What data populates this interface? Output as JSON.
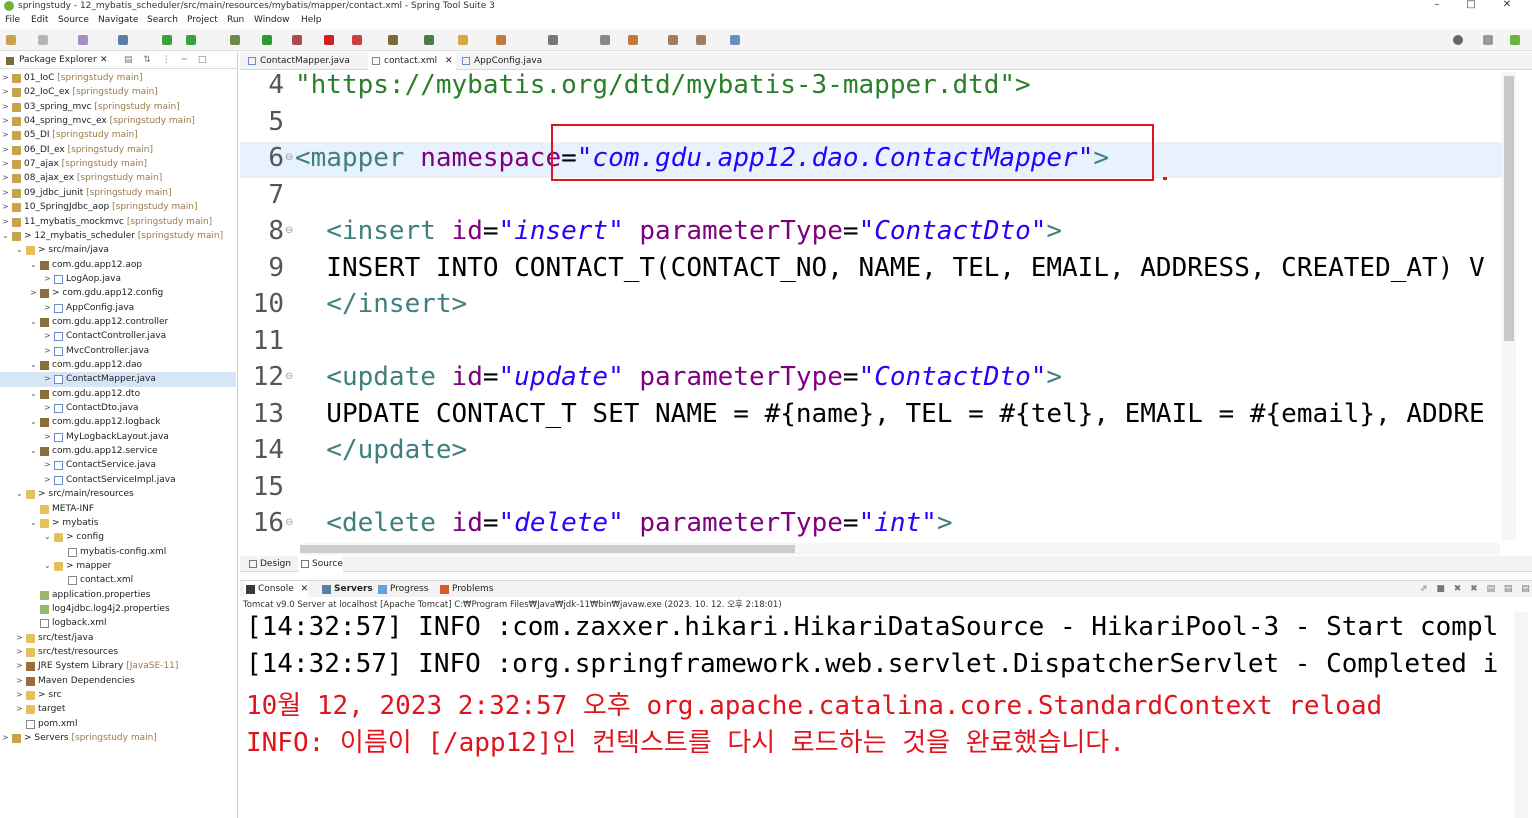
{
  "window": {
    "title": "springstudy - 12_mybatis_scheduler/src/main/resources/mybatis/mapper/contact.xml - Spring Tool Suite 3",
    "minimize": "–",
    "maximize": "□",
    "close": "✕"
  },
  "menu": [
    "File",
    "Edit",
    "Source",
    "Navigate",
    "Search",
    "Project",
    "Run",
    "Window",
    "Help"
  ],
  "explorer": {
    "title": "Package Explorer",
    "close": "✕",
    "tools": "▤ ⇅ ⋮ ─ □",
    "items": [
      {
        "label": "01_IoC",
        "suffix": " [springstudy main]"
      },
      {
        "label": "02_IoC_ex",
        "suffix": " [springstudy main]"
      },
      {
        "label": "03_spring_mvc",
        "suffix": " [springstudy main]"
      },
      {
        "label": "04_spring_mvc_ex",
        "suffix": " [springstudy main]"
      },
      {
        "label": "05_DI",
        "suffix": " [springstudy main]"
      },
      {
        "label": "06_DI_ex",
        "suffix": " [springstudy main]"
      },
      {
        "label": "07_ajax",
        "suffix": " [springstudy main]"
      },
      {
        "label": "08_ajax_ex",
        "suffix": " [springstudy main]"
      },
      {
        "label": "09_jdbc_junit",
        "suffix": " [springstudy main]"
      },
      {
        "label": "10_SpringJdbc_aop",
        "suffix": " [springstudy main]"
      },
      {
        "label": "11_mybatis_mockmvc",
        "suffix": " [springstudy main]"
      },
      {
        "label": "> 12_mybatis_scheduler",
        "suffix": " [springstudy main]"
      },
      {
        "label": "> src/main/java",
        "suffix": ""
      },
      {
        "label": "com.gdu.app12.aop",
        "suffix": ""
      },
      {
        "label": "LogAop.java",
        "suffix": ""
      },
      {
        "label": "> com.gdu.app12.config",
        "suffix": ""
      },
      {
        "label": "AppConfig.java",
        "suffix": ""
      },
      {
        "label": "com.gdu.app12.controller",
        "suffix": ""
      },
      {
        "label": "ContactController.java",
        "suffix": ""
      },
      {
        "label": "MvcController.java",
        "suffix": ""
      },
      {
        "label": "com.gdu.app12.dao",
        "suffix": ""
      },
      {
        "label": "ContactMapper.java",
        "suffix": ""
      },
      {
        "label": "com.gdu.app12.dto",
        "suffix": ""
      },
      {
        "label": "ContactDto.java",
        "suffix": ""
      },
      {
        "label": "com.gdu.app12.logback",
        "suffix": ""
      },
      {
        "label": "MyLogbackLayout.java",
        "suffix": ""
      },
      {
        "label": "com.gdu.app12.service",
        "suffix": ""
      },
      {
        "label": "ContactService.java",
        "suffix": ""
      },
      {
        "label": "ContactServiceImpl.java",
        "suffix": ""
      },
      {
        "label": "> src/main/resources",
        "suffix": ""
      },
      {
        "label": "META-INF",
        "suffix": ""
      },
      {
        "label": "> mybatis",
        "suffix": ""
      },
      {
        "label": "> config",
        "suffix": ""
      },
      {
        "label": "mybatis-config.xml",
        "suffix": ""
      },
      {
        "label": "> mapper",
        "suffix": ""
      },
      {
        "label": "contact.xml",
        "suffix": ""
      },
      {
        "label": "application.properties",
        "suffix": ""
      },
      {
        "label": "log4jdbc.log4j2.properties",
        "suffix": ""
      },
      {
        "label": "logback.xml",
        "suffix": ""
      },
      {
        "label": "src/test/java",
        "suffix": ""
      },
      {
        "label": "src/test/resources",
        "suffix": ""
      },
      {
        "label": "JRE System Library",
        "suffix": " [JavaSE-11]"
      },
      {
        "label": "Maven Dependencies",
        "suffix": ""
      },
      {
        "label": "> src",
        "suffix": ""
      },
      {
        "label": "target",
        "suffix": ""
      },
      {
        "label": "pom.xml",
        "suffix": ""
      },
      {
        "label": "> Servers",
        "suffix": " [springstudy main]"
      }
    ]
  },
  "editor_tabs": [
    {
      "label": "ContactMapper.java"
    },
    {
      "label": "contact.xml",
      "close": "✕"
    },
    {
      "label": "AppConfig.java"
    }
  ],
  "editor": {
    "lines": [
      {
        "num": "4",
        "fold": "",
        "parts": [
          {
            "c": "c-url",
            "t": "\"https://mybatis.org/dtd/mybatis-3-mapper.dtd\">"
          }
        ]
      },
      {
        "num": "5",
        "fold": "",
        "parts": []
      },
      {
        "num": "6",
        "fold": "⊖",
        "parts": [
          {
            "c": "c-tag",
            "t": "<mapper "
          },
          {
            "c": "c-attr",
            "t": "namespace"
          },
          {
            "c": "c-plain",
            "t": "="
          },
          {
            "c": "c-str",
            "t": "\"com.gdu.app12.dao.ContactMapper\""
          },
          {
            "c": "c-tag",
            "t": ">"
          }
        ]
      },
      {
        "num": "7",
        "fold": "",
        "parts": []
      },
      {
        "num": "8",
        "fold": "⊖",
        "parts": [
          {
            "c": "c-tag",
            "t": "  <insert "
          },
          {
            "c": "c-attr",
            "t": "id"
          },
          {
            "c": "c-plain",
            "t": "="
          },
          {
            "c": "c-str",
            "t": "\"insert\""
          },
          {
            "c": "c-attr",
            "t": " parameterType"
          },
          {
            "c": "c-plain",
            "t": "="
          },
          {
            "c": "c-str",
            "t": "\"ContactDto\""
          },
          {
            "c": "c-tag",
            "t": ">"
          }
        ]
      },
      {
        "num": "9",
        "fold": "",
        "parts": [
          {
            "c": "c-plain",
            "t": "  INSERT INTO CONTACT_T(CONTACT_NO, NAME, TEL, EMAIL, ADDRESS, CREATED_AT) V"
          }
        ]
      },
      {
        "num": "10",
        "fold": "",
        "parts": [
          {
            "c": "c-tag",
            "t": "  </insert>"
          }
        ]
      },
      {
        "num": "11",
        "fold": "",
        "parts": []
      },
      {
        "num": "12",
        "fold": "⊖",
        "parts": [
          {
            "c": "c-tag",
            "t": "  <update "
          },
          {
            "c": "c-attr",
            "t": "id"
          },
          {
            "c": "c-plain",
            "t": "="
          },
          {
            "c": "c-str",
            "t": "\"update\""
          },
          {
            "c": "c-attr",
            "t": " parameterType"
          },
          {
            "c": "c-plain",
            "t": "="
          },
          {
            "c": "c-str",
            "t": "\"ContactDto\""
          },
          {
            "c": "c-tag",
            "t": ">"
          }
        ]
      },
      {
        "num": "13",
        "fold": "",
        "parts": [
          {
            "c": "c-plain",
            "t": "  UPDATE CONTACT_T SET NAME = #{name}, TEL = #{tel}, EMAIL = #{email}, ADDRE"
          }
        ]
      },
      {
        "num": "14",
        "fold": "",
        "parts": [
          {
            "c": "c-tag",
            "t": "  </update>"
          }
        ]
      },
      {
        "num": "15",
        "fold": "",
        "parts": []
      },
      {
        "num": "16",
        "fold": "⊖",
        "parts": [
          {
            "c": "c-tag",
            "t": "  <delete "
          },
          {
            "c": "c-attr",
            "t": "id"
          },
          {
            "c": "c-plain",
            "t": "="
          },
          {
            "c": "c-str",
            "t": "\"delete\""
          },
          {
            "c": "c-attr",
            "t": " parameterType"
          },
          {
            "c": "c-plain",
            "t": "="
          },
          {
            "c": "c-str",
            "t": "\"int\""
          },
          {
            "c": "c-tag",
            "t": ">"
          }
        ]
      }
    ]
  },
  "bottom_tabs": {
    "design": "Design",
    "source": "Source"
  },
  "console": {
    "tabs": [
      {
        "label": "Console",
        "close": "✕"
      },
      {
        "label": "Servers"
      },
      {
        "label": "Progress"
      },
      {
        "label": "Problems"
      }
    ],
    "tools": "⇗ ■ ✖ ✖ ▤ ▤ ▤ ▤ ▤ ▣ ▾ ▢ ▾ ▢ ▾ ▢ ◉ ⚙ ─ □",
    "header": "Tomcat v9.0 Server at localhost [Apache Tomcat] C:₩Program Files₩Java₩jdk-11₩bin₩javaw.exe  (2023. 10. 12. 오후 2:18:01)",
    "lines": [
      {
        "color": "con-black",
        "text": "[14:32:57] INFO :com.zaxxer.hikari.HikariDataSource - HikariPool-3 - Start compl"
      },
      {
        "color": "con-black",
        "text": "[14:32:57] INFO :org.springframework.web.servlet.DispatcherServlet - Completed i"
      },
      {
        "color": "con-red",
        "text": "10월 12, 2023 2:32:57 오후 org.apache.catalina.core.StandardContext reload"
      },
      {
        "color": "con-red",
        "text": "INFO: 이름이 [/app12]인 컨텍스트를 다시 로드하는 것을 완료했습니다."
      }
    ]
  }
}
